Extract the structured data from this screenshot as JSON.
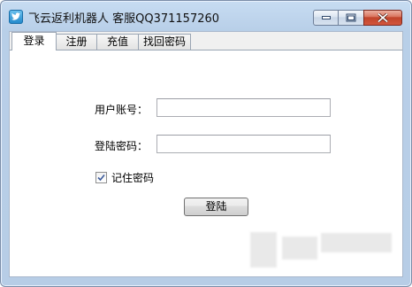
{
  "window": {
    "title": "飞云返利机器人 客服QQ371157260",
    "controls": {
      "minimize_icon": "minimize-icon",
      "maximize_icon": "maximize-icon",
      "close_icon": "close-icon",
      "close_color": "#c8452c"
    }
  },
  "tabs": [
    {
      "label": "登录",
      "active": true
    },
    {
      "label": "注册",
      "active": false
    },
    {
      "label": "充值",
      "active": false
    },
    {
      "label": "找回密码",
      "active": false
    }
  ],
  "login_form": {
    "account_label": "用户账号：",
    "account_value": "",
    "password_label": "登陆密码：",
    "password_value": "",
    "remember_label": "记住密码",
    "remember_checked": true,
    "submit_label": "登陆"
  }
}
